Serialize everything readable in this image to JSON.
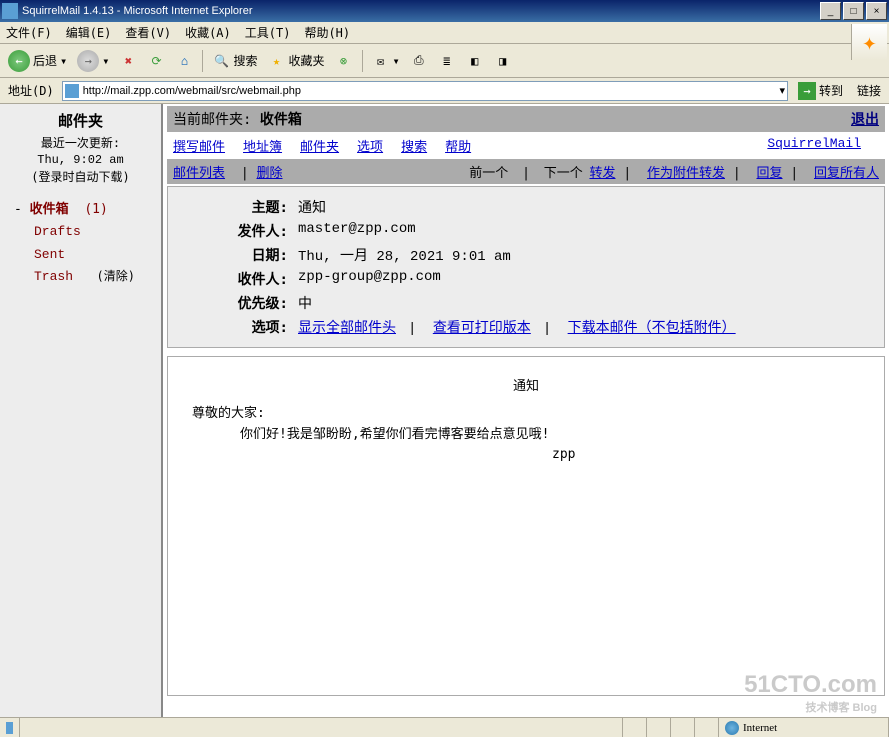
{
  "window": {
    "title": "SquirrelMail 1.4.13 - Microsoft Internet Explorer",
    "minimize": "_",
    "maximize": "□",
    "close": "×"
  },
  "menu": {
    "file": "文件(F)",
    "edit": "编辑(E)",
    "view": "查看(V)",
    "favorites": "收藏(A)",
    "tools": "工具(T)",
    "help": "帮助(H)"
  },
  "toolbar": {
    "back": "后退",
    "search": "搜索",
    "favorites": "收藏夹"
  },
  "address": {
    "label": "地址(D)",
    "url": "http://mail.zpp.com/webmail/src/webmail.php",
    "go": "转到",
    "links": "链接"
  },
  "sidebar": {
    "title": "邮件夹",
    "updated_label": "最近一次更新:",
    "updated_time": "Thu, 9:02 am",
    "auto_dl": "(登录时自动下载)",
    "inbox": "收件箱",
    "inbox_count": "(1)",
    "drafts": "Drafts",
    "sent": "Sent",
    "trash": "Trash",
    "clear": "(清除)"
  },
  "header": {
    "current_label": "当前邮件夹:",
    "current_folder": "收件箱",
    "logout": "退出"
  },
  "nav": {
    "compose": "撰写邮件",
    "addresses": "地址簿",
    "folders": "邮件夹",
    "options": "选项",
    "search": "搜索",
    "help": "帮助",
    "brand": "SquirrelMail"
  },
  "msgnav": {
    "list": "邮件列表",
    "delete": "删除",
    "prev": "前一个",
    "next": "下一个",
    "forward": "转发",
    "fwd_attach": "作为附件转发",
    "reply": "回复",
    "reply_all": "回复所有人"
  },
  "msg": {
    "subject_k": "主题:",
    "subject_v": "通知",
    "from_k": "发件人:",
    "from_v": "master@zpp.com",
    "date_k": "日期:",
    "date_v": "Thu, 一月 28, 2021 9:01 am",
    "to_k": "收件人:",
    "to_v": "zpp-group@zpp.com",
    "priority_k": "优先级:",
    "priority_v": "中",
    "options_k": "选项:",
    "opt_headers": "显示全部邮件头",
    "opt_print": "查看可打印版本",
    "opt_download": "下载本邮件（不包括附件）"
  },
  "body": {
    "title": "通知",
    "greeting": "尊敬的大家:",
    "line1": "你们好!我是邹盼盼,希望你们看完博客要给点意见哦!",
    "sig": "zpp"
  },
  "status": {
    "zone": "Internet"
  },
  "watermark": {
    "big": "51CTO.com",
    "small": "技术博客 Blog"
  }
}
